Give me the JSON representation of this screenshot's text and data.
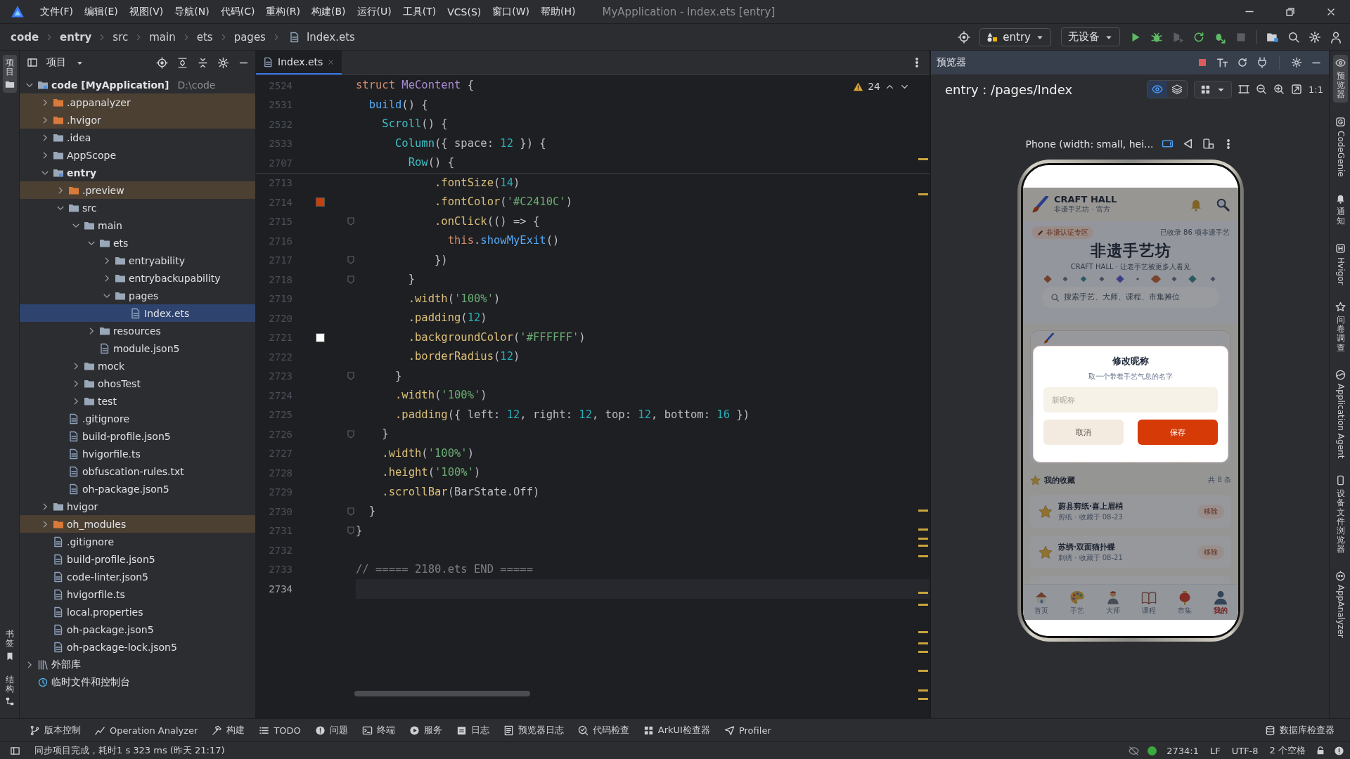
{
  "title_bar": {
    "menu": [
      "文件(F)",
      "编辑(E)",
      "视图(V)",
      "导航(N)",
      "代码(C)",
      "重构(R)",
      "构建(B)",
      "运行(U)",
      "工具(T)",
      "VCS(S)",
      "窗口(W)",
      "帮助(H)"
    ],
    "title": "MyApplication - Index.ets [entry]"
  },
  "navigation_bar": {
    "breadcrumb": [
      "code",
      "entry",
      "src",
      "main",
      "ets",
      "pages",
      "Index.ets"
    ],
    "module": "entry",
    "device": "无设备"
  },
  "left_strip": {
    "top": [
      {
        "label": "项目",
        "selected": true
      }
    ],
    "bottom": [
      {
        "label": "书签",
        "selected": false
      },
      {
        "label": "结构",
        "selected": false
      }
    ]
  },
  "project_panel": {
    "title": "项目",
    "tree": [
      {
        "label": "code [MyApplication]",
        "location": "D:\\code",
        "kind": "module",
        "expanded": true,
        "excluded": false,
        "selected": false,
        "children": [
          {
            "label": ".appanalyzer",
            "kind": "folder",
            "expanded": false,
            "excluded": true,
            "selected": false
          },
          {
            "label": ".hvigor",
            "kind": "folder",
            "expanded": false,
            "excluded": true,
            "selected": false
          },
          {
            "label": ".idea",
            "kind": "folder",
            "expanded": false,
            "excluded": false,
            "selected": false
          },
          {
            "label": "AppScope",
            "kind": "folder",
            "expanded": false,
            "excluded": false,
            "selected": false
          },
          {
            "label": "entry",
            "kind": "module",
            "expanded": true,
            "excluded": false,
            "selected": false,
            "children": [
              {
                "label": ".preview",
                "kind": "folder",
                "expanded": false,
                "excluded": true,
                "selected": false
              },
              {
                "label": "src",
                "kind": "folder",
                "expanded": true,
                "excluded": false,
                "selected": false,
                "children": [
                  {
                    "label": "main",
                    "kind": "folder",
                    "expanded": true,
                    "excluded": false,
                    "selected": false,
                    "children": [
                      {
                        "label": "ets",
                        "kind": "folder",
                        "expanded": true,
                        "excluded": false,
                        "selected": false,
                        "children": [
                          {
                            "label": "entryability",
                            "kind": "folder",
                            "expanded": false,
                            "excluded": false,
                            "selected": false
                          },
                          {
                            "label": "entrybackupability",
                            "kind": "folder",
                            "expanded": false,
                            "excluded": false,
                            "selected": false
                          },
                          {
                            "label": "pages",
                            "kind": "folder",
                            "expanded": true,
                            "excluded": false,
                            "selected": false,
                            "children": [
                              {
                                "label": "Index.ets",
                                "kind": "file",
                                "excluded": false,
                                "selected": true
                              }
                            ]
                          }
                        ]
                      },
                      {
                        "label": "resources",
                        "kind": "folder",
                        "expanded": false,
                        "excluded": false,
                        "selected": false
                      },
                      {
                        "label": "module.json5",
                        "kind": "file",
                        "excluded": false,
                        "selected": false
                      }
                    ]
                  },
                  {
                    "label": "mock",
                    "kind": "folder",
                    "expanded": false,
                    "excluded": false,
                    "selected": false
                  },
                  {
                    "label": "ohosTest",
                    "kind": "folder",
                    "expanded": false,
                    "excluded": false,
                    "selected": false
                  },
                  {
                    "label": "test",
                    "kind": "folder",
                    "expanded": false,
                    "excluded": false,
                    "selected": false
                  }
                ]
              },
              {
                "label": ".gitignore",
                "kind": "file",
                "excluded": false,
                "selected": false
              },
              {
                "label": "build-profile.json5",
                "kind": "file",
                "excluded": false,
                "selected": false
              },
              {
                "label": "hvigorfile.ts",
                "kind": "file",
                "excluded": false,
                "selected": false
              },
              {
                "label": "obfuscation-rules.txt",
                "kind": "file",
                "excluded": false,
                "selected": false
              },
              {
                "label": "oh-package.json5",
                "kind": "file",
                "excluded": false,
                "selected": false
              }
            ]
          },
          {
            "label": "hvigor",
            "kind": "folder",
            "expanded": false,
            "excluded": false,
            "selected": false
          },
          {
            "label": "oh_modules",
            "kind": "folder",
            "expanded": false,
            "excluded": true,
            "selected": false
          },
          {
            "label": ".gitignore",
            "kind": "file",
            "excluded": false,
            "selected": false
          },
          {
            "label": "build-profile.json5",
            "kind": "file",
            "excluded": false,
            "selected": false
          },
          {
            "label": "code-linter.json5",
            "kind": "file",
            "excluded": false,
            "selected": false
          },
          {
            "label": "hvigorfile.ts",
            "kind": "file",
            "excluded": false,
            "selected": false
          },
          {
            "label": "local.properties",
            "kind": "file",
            "excluded": false,
            "selected": false
          },
          {
            "label": "oh-package.json5",
            "kind": "file",
            "excluded": false,
            "selected": false
          },
          {
            "label": "oh-package-lock.json5",
            "kind": "file",
            "excluded": false,
            "selected": false
          }
        ]
      },
      {
        "label": "外部库",
        "kind": "library",
        "expanded": false,
        "excluded": false,
        "selected": false
      },
      {
        "label": "临时文件和控制台",
        "kind": "scratch",
        "excluded": false,
        "selected": false
      }
    ]
  },
  "editor": {
    "tab": {
      "label": "Index.ets",
      "selected": true
    },
    "warning_count": "24",
    "sticky_lines": [
      {
        "number": "2524",
        "tokens": [
          {
            "kind": "kw",
            "text": "struct "
          },
          {
            "kind": "type",
            "text": "MeContent"
          },
          {
            "kind": "plain",
            "text": " {"
          }
        ]
      },
      {
        "number": "2531",
        "tokens": [
          {
            "kind": "fn",
            "text": "  build"
          },
          {
            "kind": "plain",
            "text": "() {"
          }
        ]
      },
      {
        "number": "2532",
        "tokens": [
          {
            "kind": "comp",
            "text": "    Scroll"
          },
          {
            "kind": "plain",
            "text": "() {"
          }
        ]
      },
      {
        "number": "2533",
        "tokens": [
          {
            "kind": "comp",
            "text": "      Column"
          },
          {
            "kind": "plain",
            "text": "({ space: "
          },
          {
            "kind": "num",
            "text": "12"
          },
          {
            "kind": "plain",
            "text": " }) {"
          }
        ]
      },
      {
        "number": "2707",
        "tokens": [
          {
            "kind": "comp",
            "text": "        Row"
          },
          {
            "kind": "plain",
            "text": "() {"
          }
        ]
      }
    ],
    "lines": [
      {
        "number": "2713",
        "fold": false,
        "current": false,
        "tokens": [
          {
            "kind": "method",
            "text": "            .fontSize"
          },
          {
            "kind": "plain",
            "text": "("
          },
          {
            "kind": "num",
            "text": "14"
          },
          {
            "kind": "plain",
            "text": ")"
          }
        ]
      },
      {
        "number": "2714",
        "fold": false,
        "current": false,
        "color": "#C2410C",
        "tokens": [
          {
            "kind": "method",
            "text": "            .fontColor"
          },
          {
            "kind": "plain",
            "text": "("
          },
          {
            "kind": "str",
            "text": "'#C2410C'"
          },
          {
            "kind": "plain",
            "text": ")"
          }
        ]
      },
      {
        "number": "2715",
        "fold": true,
        "current": false,
        "tokens": [
          {
            "kind": "method",
            "text": "            .onClick"
          },
          {
            "kind": "plain",
            "text": "(() => {"
          }
        ]
      },
      {
        "number": "2716",
        "fold": false,
        "current": false,
        "tokens": [
          {
            "kind": "kw",
            "text": "              this"
          },
          {
            "kind": "plain",
            "text": "."
          },
          {
            "kind": "fn",
            "text": "showMyExit"
          },
          {
            "kind": "plain",
            "text": "()"
          }
        ]
      },
      {
        "number": "2717",
        "fold": true,
        "current": false,
        "tokens": [
          {
            "kind": "plain",
            "text": "            })"
          }
        ]
      },
      {
        "number": "2718",
        "fold": true,
        "current": false,
        "tokens": [
          {
            "kind": "plain",
            "text": "        }"
          }
        ]
      },
      {
        "number": "2719",
        "fold": false,
        "current": false,
        "tokens": [
          {
            "kind": "method",
            "text": "        .width"
          },
          {
            "kind": "plain",
            "text": "("
          },
          {
            "kind": "str",
            "text": "'100%'"
          },
          {
            "kind": "plain",
            "text": ")"
          }
        ]
      },
      {
        "number": "2720",
        "fold": false,
        "current": false,
        "tokens": [
          {
            "kind": "method",
            "text": "        .padding"
          },
          {
            "kind": "plain",
            "text": "("
          },
          {
            "kind": "num",
            "text": "12"
          },
          {
            "kind": "plain",
            "text": ")"
          }
        ]
      },
      {
        "number": "2721",
        "fold": false,
        "current": false,
        "color": "#FFFFFF",
        "tokens": [
          {
            "kind": "method",
            "text": "        .backgroundColor"
          },
          {
            "kind": "plain",
            "text": "("
          },
          {
            "kind": "str",
            "text": "'#FFFFFF'"
          },
          {
            "kind": "plain",
            "text": ")"
          }
        ]
      },
      {
        "number": "2722",
        "fold": false,
        "current": false,
        "tokens": [
          {
            "kind": "method",
            "text": "        .borderRadius"
          },
          {
            "kind": "plain",
            "text": "("
          },
          {
            "kind": "num",
            "text": "12"
          },
          {
            "kind": "plain",
            "text": ")"
          }
        ]
      },
      {
        "number": "2723",
        "fold": true,
        "current": false,
        "tokens": [
          {
            "kind": "plain",
            "text": "      }"
          }
        ]
      },
      {
        "number": "2724",
        "fold": false,
        "current": false,
        "tokens": [
          {
            "kind": "method",
            "text": "      .width"
          },
          {
            "kind": "plain",
            "text": "("
          },
          {
            "kind": "str",
            "text": "'100%'"
          },
          {
            "kind": "plain",
            "text": ")"
          }
        ]
      },
      {
        "number": "2725",
        "fold": false,
        "current": false,
        "tokens": [
          {
            "kind": "method",
            "text": "      .padding"
          },
          {
            "kind": "plain",
            "text": "({ left: "
          },
          {
            "kind": "num",
            "text": "12"
          },
          {
            "kind": "plain",
            "text": ", right: "
          },
          {
            "kind": "num",
            "text": "12"
          },
          {
            "kind": "plain",
            "text": ", top: "
          },
          {
            "kind": "num",
            "text": "12"
          },
          {
            "kind": "plain",
            "text": ", bottom: "
          },
          {
            "kind": "num",
            "text": "16"
          },
          {
            "kind": "plain",
            "text": " })"
          }
        ]
      },
      {
        "number": "2726",
        "fold": true,
        "current": false,
        "tokens": [
          {
            "kind": "plain",
            "text": "    }"
          }
        ]
      },
      {
        "number": "2727",
        "fold": false,
        "current": false,
        "tokens": [
          {
            "kind": "method",
            "text": "    .width"
          },
          {
            "kind": "plain",
            "text": "("
          },
          {
            "kind": "str",
            "text": "'100%'"
          },
          {
            "kind": "plain",
            "text": ")"
          }
        ]
      },
      {
        "number": "2728",
        "fold": false,
        "current": false,
        "tokens": [
          {
            "kind": "method",
            "text": "    .height"
          },
          {
            "kind": "plain",
            "text": "("
          },
          {
            "kind": "str",
            "text": "'100%'"
          },
          {
            "kind": "plain",
            "text": ")"
          }
        ]
      },
      {
        "number": "2729",
        "fold": false,
        "current": false,
        "tokens": [
          {
            "kind": "method",
            "text": "    .scrollBar"
          },
          {
            "kind": "plain",
            "text": "(BarState.Off)"
          }
        ]
      },
      {
        "number": "2730",
        "fold": true,
        "current": false,
        "tokens": [
          {
            "kind": "plain",
            "text": "  }"
          }
        ]
      },
      {
        "number": "2731",
        "fold": true,
        "current": false,
        "tokens": [
          {
            "kind": "plain",
            "text": "}"
          }
        ]
      },
      {
        "number": "2732",
        "fold": false,
        "current": false
      },
      {
        "number": "2733",
        "fold": false,
        "current": false,
        "tokens": [
          {
            "kind": "comment",
            "text": "// ===== 2180.ets END ====="
          }
        ]
      },
      {
        "number": "2734",
        "fold": false,
        "current": true
      }
    ]
  },
  "preview": {
    "title": "预览器",
    "route": "entry : /pages/Index",
    "view_toggles": [
      {
        "selected": true
      },
      {
        "selected": false
      }
    ],
    "zoom_reset": "1:1",
    "device_label": "Phone (width: small, hei...",
    "app": {
      "brand": "CRAFT HALL",
      "brand_subtitle": "非遗手艺坊 · 官方",
      "badge": "非遗认证专区",
      "count": "已收录 86 项非遗手艺",
      "headline": "非遗手艺坊",
      "tagline": "CRAFT HALL · 让老手艺被更多人看见",
      "search_placeholder": "搜索手艺、大师、课程、市集摊位",
      "dialog": {
        "title": "修改昵称",
        "hint": "取一个带着手艺气息的名字",
        "placeholder": "新昵称",
        "buttons": [
          {
            "label": "取消",
            "kind": "secondary"
          },
          {
            "label": "保存",
            "kind": "primary"
          }
        ]
      },
      "favorites": {
        "title": "我的收藏",
        "total": "共 8 条",
        "items": [
          {
            "name": "蔚县剪纸·喜上眉梢",
            "meta": "剪纸 · 收藏于 08-23",
            "action": "移除"
          },
          {
            "name": "苏绣·双面猫扑蝶",
            "meta": "刺绣 · 收藏于 08-21",
            "action": "移除"
          }
        ]
      },
      "nav": [
        {
          "label": "首页",
          "selected": false
        },
        {
          "label": "手艺",
          "selected": false
        },
        {
          "label": "大师",
          "selected": false
        },
        {
          "label": "课程",
          "selected": false
        },
        {
          "label": "市集",
          "selected": false
        },
        {
          "label": "我的",
          "selected": true
        }
      ]
    }
  },
  "right_strip": [
    {
      "label": "预览器",
      "kind": "cjk",
      "selected": true
    },
    {
      "label": "CodeGenie",
      "kind": "latin",
      "selected": false
    },
    {
      "label": "通知",
      "kind": "cjk",
      "selected": false
    },
    {
      "label": "Hvigor",
      "kind": "latin",
      "selected": false
    },
    {
      "label": "问卷调查",
      "kind": "cjk",
      "selected": false
    },
    {
      "label": "Application Agent",
      "kind": "latin",
      "selected": false
    },
    {
      "label": "设备文件浏览器",
      "kind": "cjk",
      "selected": false
    },
    {
      "label": "AppAnalyzer",
      "kind": "latin",
      "selected": false
    }
  ],
  "tool_windows": [
    "版本控制",
    "Operation Analyzer",
    "构建",
    "TODO",
    "问题",
    "终端",
    "服务",
    "日志",
    "预览器日志",
    "代码检查",
    "ArkUI检查器",
    "Profiler"
  ],
  "tool_windows_right": [
    "数据库检查器"
  ],
  "status_bar": {
    "message": "同步项目完成，耗时1 s 323 ms (昨天 21:17)",
    "position": "2734:1",
    "line_separator": "LF",
    "encoding": "UTF-8",
    "indent": "2 个空格"
  }
}
